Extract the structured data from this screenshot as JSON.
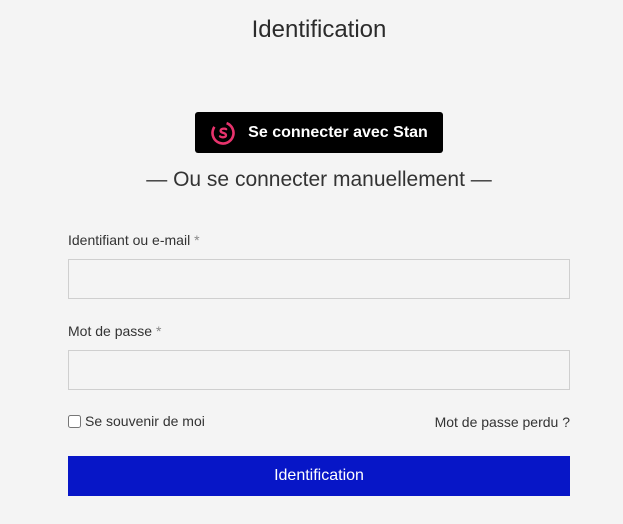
{
  "page": {
    "title": "Identification"
  },
  "sso": {
    "button_label": "Se connecter avec Stan",
    "icon": "stan-logo-icon",
    "logo_color": "#e8336d"
  },
  "separator": {
    "text": "— Ou se connecter manuellement —"
  },
  "form": {
    "username": {
      "label": "Identifiant ou e-mail",
      "required_mark": "*",
      "value": ""
    },
    "password": {
      "label": "Mot de passe",
      "required_mark": "*",
      "value": ""
    },
    "remember_me": {
      "label": "Se souvenir de moi",
      "checked": false
    },
    "lost_password_link": "Mot de passe perdu ?",
    "submit_label": "Identification"
  },
  "colors": {
    "background": "#f4f4f4",
    "primary_button": "#0716c7",
    "sso_button": "#000000"
  }
}
